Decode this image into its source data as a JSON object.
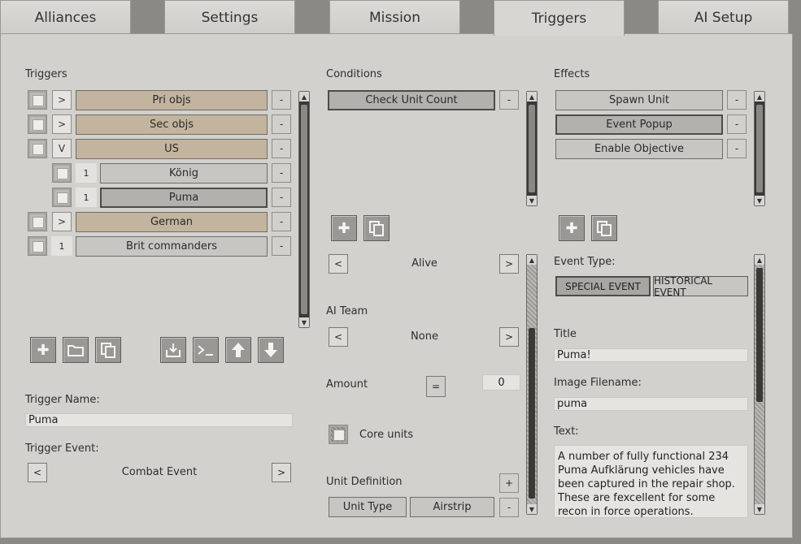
{
  "tabs": [
    "Alliances",
    "Settings",
    "Mission",
    "Triggers",
    "AI Setup"
  ],
  "triggers": {
    "heading": "Triggers",
    "rows": [
      {
        "toggle": ">",
        "label": "Pri objs"
      },
      {
        "toggle": ">",
        "label": "Sec objs"
      },
      {
        "toggle": "V",
        "label": "US"
      },
      {
        "toggle": "1",
        "label": "König"
      },
      {
        "toggle": "1",
        "label": "Puma"
      },
      {
        "toggle": ">",
        "label": "German"
      },
      {
        "toggle": "1",
        "label": "Brit commanders"
      }
    ],
    "dash": "-",
    "trigger_name_label": "Trigger Name:",
    "trigger_name": "Puma",
    "trigger_event_label": "Trigger Event:",
    "trigger_event": "Combat Event",
    "left_arrow": "<",
    "right_arrow": ">"
  },
  "conditions": {
    "heading": "Conditions",
    "items": [
      "Check Unit Count"
    ],
    "alive": "Alive",
    "ai_team_label": "AI Team",
    "ai_team": "None",
    "amount_label": "Amount",
    "amount_op": "=",
    "amount_value": "0",
    "core_units_label": "Core units",
    "unit_def_label": "Unit Definition",
    "unit_def_plus": "+",
    "unit_type": "Unit Type",
    "unit_value": "Airstrip"
  },
  "effects": {
    "heading": "Effects",
    "items": [
      "Spawn Unit",
      "Event Popup",
      "Enable Objective"
    ],
    "event_type_label": "Event Type:",
    "special_event": "SPECIAL EVENT",
    "historical_event": "HISTORICAL EVENT",
    "title_label": "Title",
    "title": "Puma!",
    "image_label": "Image Filename:",
    "image": "puma",
    "text_label": "Text:",
    "text": "A number of fully functional 234 Puma Aufklärung vehicles have been captured in the repair shop. These are fexcellent for some recon in force operations."
  }
}
